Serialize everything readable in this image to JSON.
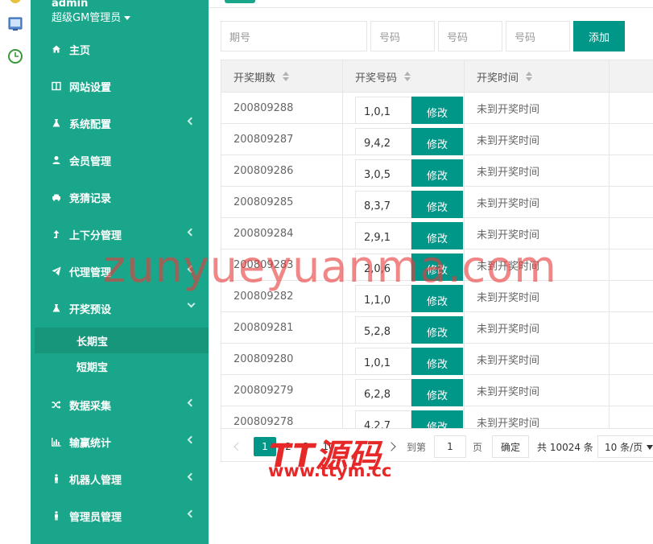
{
  "sidebar": {
    "user": {
      "name": "admin",
      "role": "超级GM管理员"
    },
    "items": [
      {
        "label": "主页",
        "icon": "home-icon",
        "chevron": false
      },
      {
        "label": "网站设置",
        "icon": "columns-icon",
        "chevron": false
      },
      {
        "label": "系统配置",
        "icon": "flask-icon",
        "chevron": true
      },
      {
        "label": "会员管理",
        "icon": "user-icon",
        "chevron": false
      },
      {
        "label": "竞猜记录",
        "icon": "car-icon",
        "chevron": false
      },
      {
        "label": "上下分管理",
        "icon": "level-up-icon",
        "chevron": true
      },
      {
        "label": "代理管理",
        "icon": "paper-plane-icon",
        "chevron": true
      },
      {
        "label": "开奖预设",
        "icon": "flask-icon",
        "chevron": true,
        "expanded": true
      },
      {
        "label": "数据采集",
        "icon": "random-icon",
        "chevron": true
      },
      {
        "label": "输赢统计",
        "icon": "bar-chart-icon",
        "chevron": true
      },
      {
        "label": "机器人管理",
        "icon": "male-icon",
        "chevron": true
      },
      {
        "label": "管理员管理",
        "icon": "male-icon",
        "chevron": true
      }
    ],
    "subitems": [
      {
        "label": "长期宝",
        "active": true
      },
      {
        "label": "短期宝",
        "active": false
      }
    ]
  },
  "form": {
    "period_placeholder": "期号",
    "num1_placeholder": "号码",
    "num2_placeholder": "号码",
    "num3_placeholder": "号码",
    "add_label": "添加"
  },
  "table": {
    "headers": [
      "开奖期数",
      "开奖号码",
      "开奖时间"
    ],
    "edit_label": "修改",
    "rows": [
      {
        "period": "200809288",
        "numbers": "1,0,1",
        "time": "未到开奖时间"
      },
      {
        "period": "200809287",
        "numbers": "9,4,2",
        "time": "未到开奖时间"
      },
      {
        "period": "200809286",
        "numbers": "3,0,5",
        "time": "未到开奖时间"
      },
      {
        "period": "200809285",
        "numbers": "8,3,7",
        "time": "未到开奖时间"
      },
      {
        "period": "200809284",
        "numbers": "2,9,1",
        "time": "未到开奖时间"
      },
      {
        "period": "200809283",
        "numbers": "2,0,6",
        "time": "未到开奖时间"
      },
      {
        "period": "200809282",
        "numbers": "1,1,0",
        "time": "未到开奖时间"
      },
      {
        "period": "200809281",
        "numbers": "5,2,8",
        "time": "未到开奖时间"
      },
      {
        "period": "200809280",
        "numbers": "1,0,1",
        "time": "未到开奖时间"
      },
      {
        "period": "200809279",
        "numbers": "6,2,8",
        "time": "未到开奖时间"
      },
      {
        "period": "200809278",
        "numbers": "4,2,7",
        "time": "未到开奖时间"
      }
    ]
  },
  "pager": {
    "pages": [
      "1",
      "2",
      "3",
      "10"
    ],
    "goto_label": "到第",
    "goto_value": "1",
    "page_unit": "页",
    "confirm_label": "确定",
    "total_label": "共 10024 条",
    "page_size": "10 条/页"
  },
  "watermark": {
    "line1": "zunyueyuanma.com",
    "line2": "TT源码",
    "line3": "www.ttym.cc"
  },
  "colors": {
    "sidebar": "#1aa68a",
    "primary_button": "#009688",
    "watermark": "#e62828"
  }
}
